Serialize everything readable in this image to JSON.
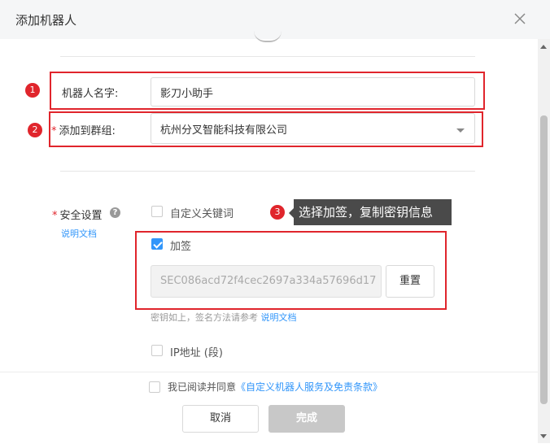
{
  "dialog": {
    "title": "添加机器人"
  },
  "annotations": {
    "badge1": "1",
    "badge2": "2",
    "badge3": "3",
    "tooltip": "选择加签，复制密钥信息"
  },
  "form": {
    "robot_name_label": "机器人名字:",
    "robot_name_value": "影刀小助手",
    "group_label": "添加到群组:",
    "group_value": "杭州分叉智能科技有限公司",
    "required_mark": "*",
    "security_label": "安全设置",
    "security_doc_link": "说明文档",
    "help_icon": "?",
    "options": {
      "custom_keyword": {
        "label": "自定义关键词",
        "checked": false
      },
      "sign": {
        "label": "加签",
        "checked": true
      },
      "ip": {
        "label": "IP地址 (段)",
        "checked": false
      }
    },
    "secret_value": "SEC086acd72f4cec2697a334a57696d17",
    "reset_label": "重置",
    "hint_text": "密钥如上，签名方法请参考",
    "hint_link": "说明文档"
  },
  "footer": {
    "agree_text": "我已阅读并同意",
    "agree_link": "《自定义机器人服务及免责条款》",
    "cancel_label": "取消",
    "done_label": "完成"
  },
  "colors": {
    "accent": "#3296fa",
    "annotation_red": "#e0252c"
  }
}
